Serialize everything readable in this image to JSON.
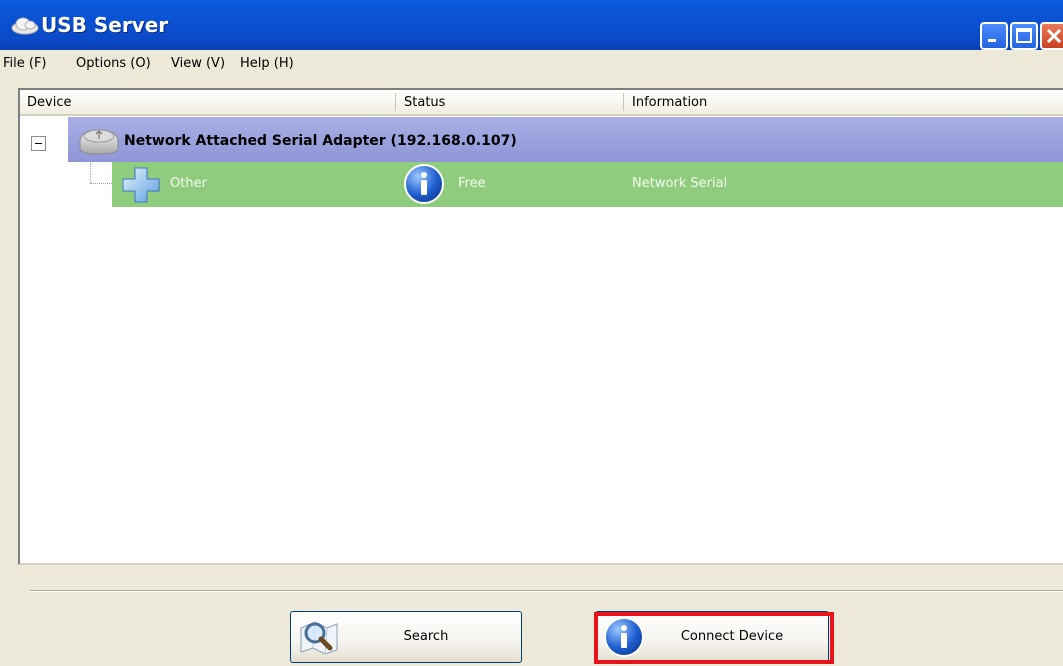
{
  "window": {
    "title": "USB Server"
  },
  "menu": {
    "items": [
      "File (F)",
      "Options (O)",
      "View (V)",
      "Help (H)"
    ]
  },
  "list": {
    "columns": [
      "Device",
      "Status",
      "Information"
    ],
    "adapter": {
      "name": "Network Attached Serial Adapter  (192.168.0.107)"
    },
    "devices": [
      {
        "device": "Other",
        "status": "Free",
        "information": "Network Serial"
      }
    ]
  },
  "buttons": {
    "search": "Search",
    "connect": "Connect Device"
  },
  "colors": {
    "titlebar": "#0a52d6",
    "adapter_row": "#9ca2dc",
    "device_row": "#90cc7d",
    "highlight": "#e8141a"
  },
  "icons": {
    "title": "cloud-usb-icon",
    "adapter": "usb-hub-icon",
    "device": "puzzle-plus-icon",
    "status": "info-icon",
    "search": "magnifier-map-icon",
    "connect": "info-icon"
  }
}
